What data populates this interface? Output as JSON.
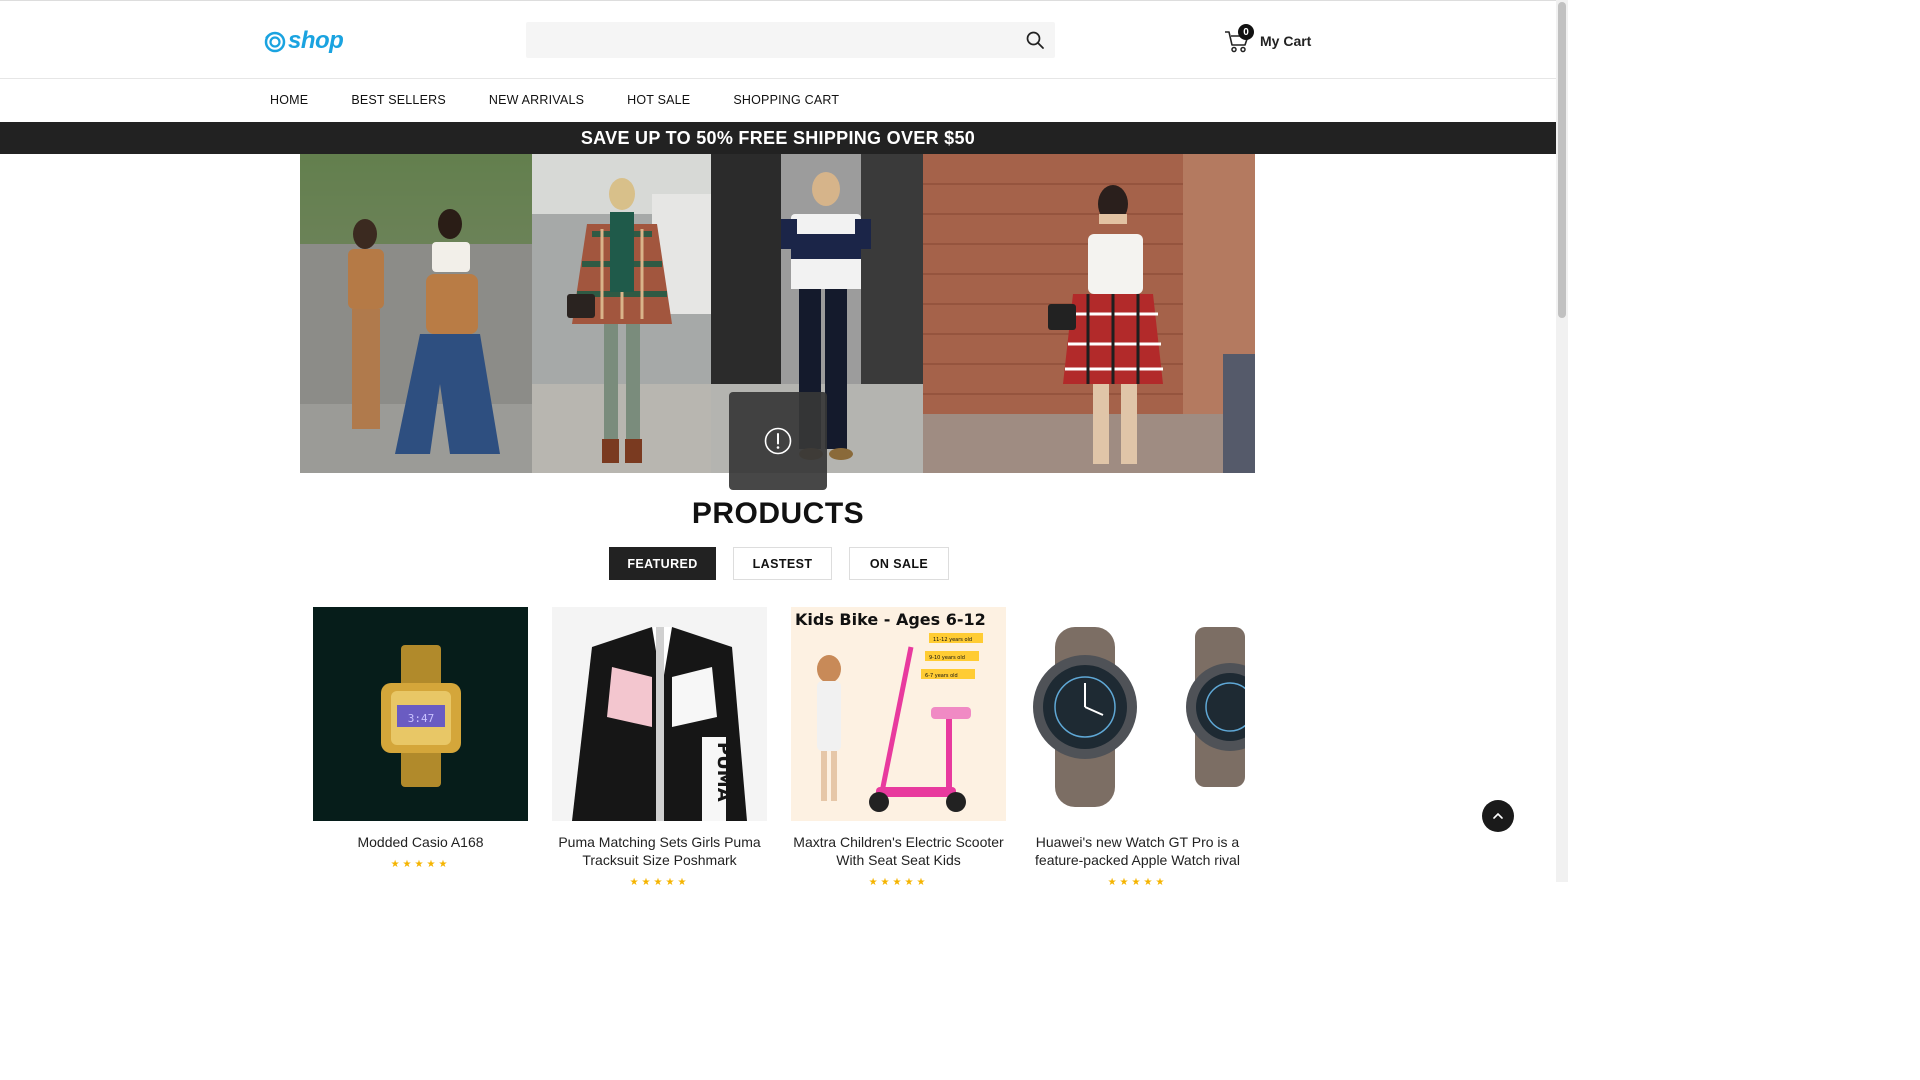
{
  "header": {
    "logo_text": "shop",
    "search": {
      "placeholder": "",
      "value": ""
    },
    "cart": {
      "count": "0",
      "label": "My Cart"
    }
  },
  "nav": {
    "items": [
      {
        "label": "HOME"
      },
      {
        "label": "BEST SELLERS"
      },
      {
        "label": "NEW ARRIVALS"
      },
      {
        "label": "HOT SALE"
      },
      {
        "label": "SHOPPING CART"
      }
    ]
  },
  "promo": {
    "text": "SAVE UP TO 50% FREE SHIPPING OVER $50"
  },
  "products": {
    "title": "PRODUCTS",
    "tabs": [
      {
        "label": "FEATURED",
        "active": true
      },
      {
        "label": "LASTEST",
        "active": false
      },
      {
        "label": "ON SALE",
        "active": false
      }
    ],
    "items": [
      {
        "name": "Modded Casio A168",
        "rating": 5
      },
      {
        "name": "Puma Matching Sets Girls Puma Tracksuit Size Poshmark",
        "rating": 5
      },
      {
        "name": "Maxtra Children's Electric Scooter With Seat Seat Kids",
        "rating": 5
      },
      {
        "name": "Huawei's new Watch GT Pro is a feature-packed Apple Watch rival",
        "rating": 5
      }
    ],
    "scooter_banner": {
      "title": "Kids Bike - Ages 6-12",
      "levels": [
        "11-12 years old",
        "9-10 years old",
        "6-7 years old"
      ]
    },
    "puma_logo_text": "PUMA"
  },
  "colors": {
    "accent": "#1aa3e0",
    "dark": "#222222",
    "star": "#f5b400"
  }
}
